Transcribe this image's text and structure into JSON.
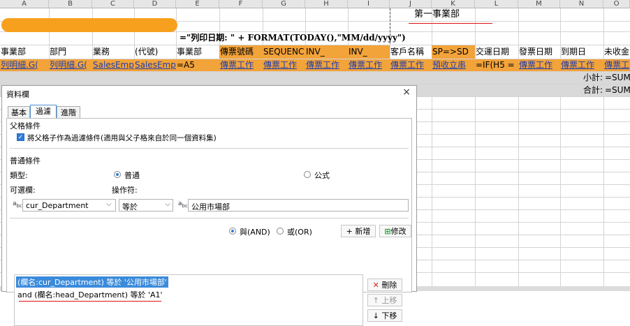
{
  "sheet": {
    "columns": [
      "A",
      "B",
      "C",
      "D",
      "E",
      "F",
      "G",
      "H",
      "I",
      "J",
      "K",
      "L",
      "M",
      "N",
      "O"
    ],
    "dept_title": "第一事業部",
    "print_date_formula": "=\"列印日期: \" + FORMAT(TODAY(),\"MM/dd/yyyy\")",
    "headers": [
      "事業部",
      "部門",
      "業務",
      "(代號)",
      "事業部",
      "傳票號碼",
      "SEQUENC",
      "INV_",
      "INV_",
      "客戶名稱",
      "SP=>SD",
      "交運日期",
      "發票日期",
      "到期日",
      "未收金"
    ],
    "row1": [
      "列明細.G(",
      "列明細.G(",
      "SalesEmpl",
      "SalesEmpl",
      "=A5",
      "傳票工作",
      "傳票工作",
      "傳票工作",
      "傳票工作",
      "傳票工作",
      "預收立串",
      "=IF(H5 =",
      "傳票工作",
      "傳票工作",
      "傳票工"
    ],
    "subtotal_label": "小計:",
    "subtotal_value": "=SUM",
    "total_label": "合計:",
    "total_value": "=SUM"
  },
  "dialog": {
    "title": "資料欄",
    "close_glyph": "×",
    "tabs": [
      "基本",
      "過濾",
      "進階"
    ],
    "active_tab": 1,
    "parent_section": "父格條件",
    "parent_checkbox_label": "將父格子作為過濾條件(適用與父子格來自於同一個資料集)",
    "parent_checkbox_checked": true,
    "normal_section": "普通條件",
    "type_label": "類型:",
    "type_option_normal": "普通",
    "type_option_formula": "公式",
    "type_selected": "普通",
    "field_label": "可選欄:",
    "operator_label": "操作符:",
    "field_value": "cur_Department",
    "operator_value": "等於",
    "compare_value": "公用市場部",
    "and_label": "與(AND)",
    "or_label": "或(OR)",
    "logic_selected": "AND",
    "add_button": "新增",
    "modify_button": "修改",
    "delete_button": "刪除",
    "up_button": "上移",
    "down_button": "下移",
    "conditions": [
      "(欄名:cur_Department) 等於 '公用市場部'",
      "and (欄名:head_Department) 等於 'A1'"
    ]
  },
  "colors": {
    "header_orange": "#f2a33a",
    "redacted_orange": "#f7a01e",
    "accent_blue": "#2f7bd8",
    "selection": "#3b8bdb",
    "annotation_red": "#d11111"
  },
  "icons": [
    "abc-field-icon",
    "abc-operator-icon",
    "chevron-down-icon",
    "close-icon",
    "add-icon",
    "modify-icon",
    "delete-x-icon",
    "arrow-up-icon",
    "arrow-down-icon"
  ]
}
